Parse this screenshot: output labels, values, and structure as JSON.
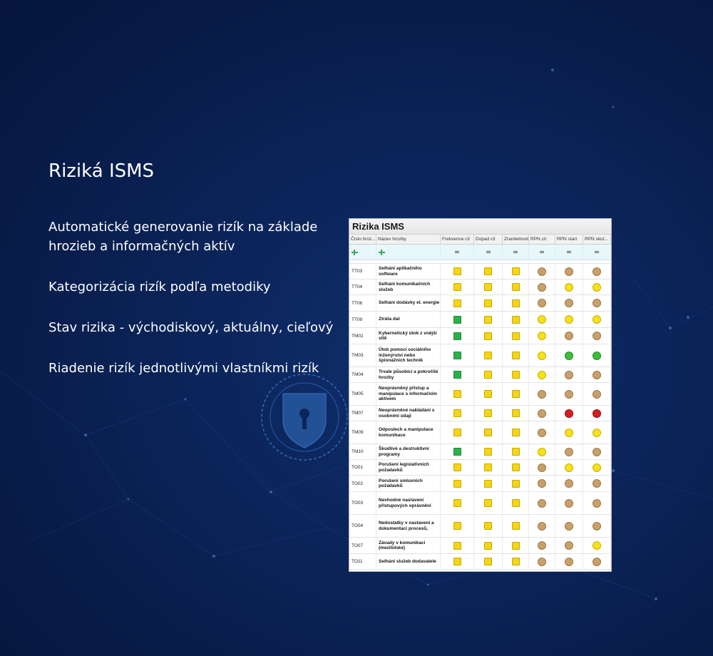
{
  "heading": "Riziká ISMS",
  "features": [
    "Automatické generovanie rizík na základe hrozieb a informačných aktív",
    "Kategorizácia rizík podľa metodiky",
    "Stav rizika - východiskový, aktuálny, cieľový",
    "Riadenie rizík jednotlivými vlastníkmi rizík"
  ],
  "panel": {
    "title": "Rizika ISMS",
    "columns": [
      "Číslo hroz...",
      "Název hrozby",
      "Frekvence cíl",
      "Dopad cíl",
      "Zranitelnost",
      "RPN cíl",
      "RPN start",
      "RPN skut..."
    ],
    "colors": {
      "yellow": "#f5d515",
      "green": "#2db04a",
      "tan": "#c8a06a",
      "circle_yellow": "#f6e11a",
      "circle_green": "#3bbf3b",
      "red": "#d81e1e"
    },
    "rows": [
      {
        "code": "TT03",
        "name": "Selhání aplikačního software",
        "f": "yellow",
        "d": "yellow",
        "z": "yellow",
        "rc": "tan",
        "rs": "tan",
        "rk": "tan",
        "h": 22
      },
      {
        "code": "TT04",
        "name": "Selhání komunikačních služeb",
        "f": "yellow",
        "d": "yellow",
        "z": "yellow",
        "rc": "tan",
        "rs": "yellow",
        "rk": "yellow",
        "h": 22
      },
      {
        "code": "TT06",
        "name": "Selhání dodávky el. energie",
        "f": "yellow",
        "d": "yellow",
        "z": "yellow",
        "rc": "tan",
        "rs": "tan",
        "rk": "tan",
        "h": 23
      },
      {
        "code": "TT09",
        "name": "Ztráta dat",
        "f": "green",
        "d": "yellow",
        "z": "yellow",
        "rc": "yellow",
        "rs": "yellow",
        "rk": "yellow",
        "h": 23
      },
      {
        "code": "TM02",
        "name": "Kybernetický útok z vnější sítě",
        "f": "green",
        "d": "yellow",
        "z": "yellow",
        "rc": "yellow",
        "rs": "tan",
        "rk": "tan",
        "h": 23
      },
      {
        "code": "TM03",
        "name": "Útok pomocí sociálního inženýrství nebo špionážních technik",
        "f": "green",
        "d": "yellow",
        "z": "yellow",
        "rc": "yellow",
        "rs": "green",
        "rk": "green",
        "h": 32
      },
      {
        "code": "TM04",
        "name": "Trvale působící a pokročilé hrozby",
        "f": "green",
        "d": "yellow",
        "z": "yellow",
        "rc": "yellow",
        "rs": "tan",
        "rk": "tan",
        "h": 22
      },
      {
        "code": "TM05",
        "name": "Neoprávněný přístup a manipulace s informačním aktivem",
        "f": "yellow",
        "d": "yellow",
        "z": "yellow",
        "rc": "tan",
        "rs": "tan",
        "rk": "tan",
        "h": 32
      },
      {
        "code": "TM07",
        "name": "Neoprávněné nakládání s osobními údaji",
        "f": "yellow",
        "d": "yellow",
        "z": "yellow",
        "rc": "tan",
        "rs": "red",
        "rk": "red",
        "h": 22
      },
      {
        "code": "TM09",
        "name": "Odposlech a manipulace komunikace",
        "f": "yellow",
        "d": "yellow",
        "z": "yellow",
        "rc": "tan",
        "rs": "yellow",
        "rk": "yellow",
        "h": 32
      },
      {
        "code": "TM10",
        "name": "Škodlivé a destruktivní programy",
        "f": "green",
        "d": "yellow",
        "z": "yellow",
        "rc": "yellow",
        "rs": "tan",
        "rk": "tan",
        "h": 22
      },
      {
        "code": "TO01",
        "name": "Porušení legislativních požadavků",
        "f": "yellow",
        "d": "yellow",
        "z": "yellow",
        "rc": "tan",
        "rs": "yellow",
        "rk": "yellow",
        "h": 22
      },
      {
        "code": "TO02",
        "name": "Porušení smluvních požadavků",
        "f": "yellow",
        "d": "yellow",
        "z": "yellow",
        "rc": "tan",
        "rs": "tan",
        "rk": "tan",
        "h": 23
      },
      {
        "code": "TO03",
        "name": "Nevhodné nastavení přístupových oprávnění",
        "f": "yellow",
        "d": "yellow",
        "z": "yellow",
        "rc": "tan",
        "rs": "tan",
        "rk": "tan",
        "h": 32
      },
      {
        "code": "TO04",
        "name": "Nedostatky v nastavení a dokumentaci procesů,",
        "f": "yellow",
        "d": "yellow",
        "z": "yellow",
        "rc": "tan",
        "rs": "tan",
        "rk": "tan",
        "h": 32
      },
      {
        "code": "TO07",
        "name": "Závady v komunikaci (mezilidské)",
        "f": "yellow",
        "d": "yellow",
        "z": "yellow",
        "rc": "tan",
        "rs": "tan",
        "rk": "yellow",
        "h": 23
      },
      {
        "code": "TO11",
        "name": "Selhání služeb dodavatele",
        "f": "yellow",
        "d": "yellow",
        "z": "yellow",
        "rc": "tan",
        "rs": "tan",
        "rk": "tan",
        "h": 22
      }
    ]
  }
}
